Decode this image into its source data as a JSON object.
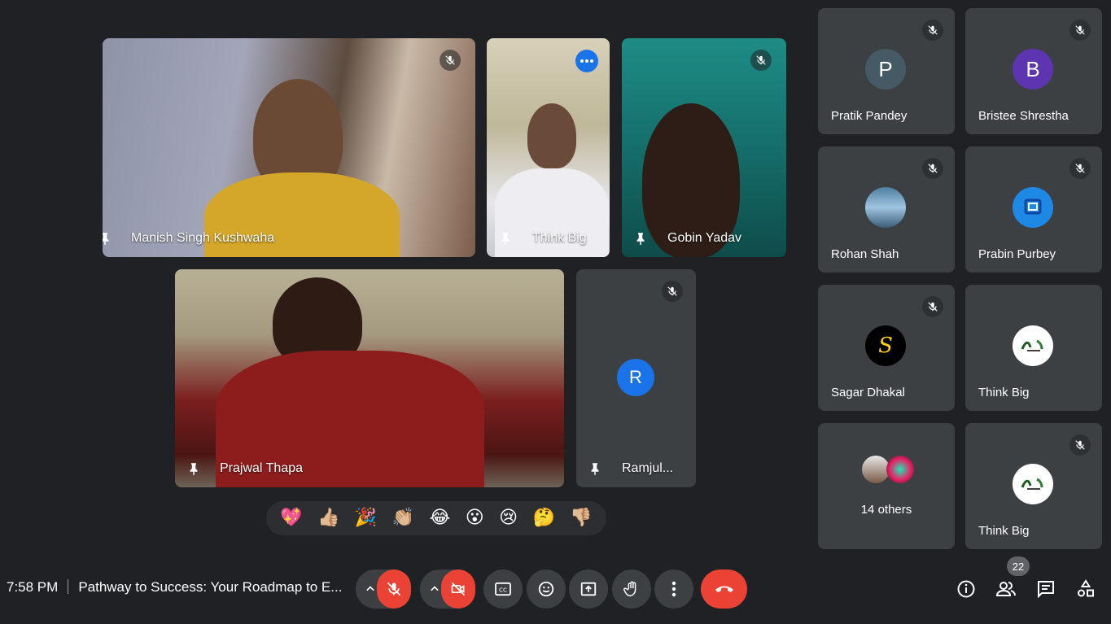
{
  "stage": {
    "tiles": [
      {
        "name": "Manish Singh Kushwaha"
      },
      {
        "name": "Think Big"
      },
      {
        "name": "Gobin Yadav"
      },
      {
        "name": "Prajwal Thapa"
      },
      {
        "name": "Ramjul...",
        "avatar": "R",
        "avatar_color": "#1a73e8"
      }
    ]
  },
  "reactions": [
    "💖",
    "👍🏼",
    "🎉",
    "👏🏼",
    "😂",
    "😮",
    "😢",
    "🤔",
    "👎🏼"
  ],
  "sidebar": {
    "participants": [
      {
        "name": "Pratik Pandey",
        "avatar": "P",
        "avatar_color": "#455a64"
      },
      {
        "name": "Bristee Shrestha",
        "avatar": "B",
        "avatar_color": "#5e35b1"
      },
      {
        "name": "Rohan Shah",
        "avatar": "",
        "avatar_color": "#4f7fa0"
      },
      {
        "name": "Prabin Purbey",
        "avatar": "",
        "avatar_color": "#1e88e5"
      },
      {
        "name": "Sagar Dhakal",
        "avatar": "S",
        "avatar_color": "#000000"
      },
      {
        "name": "Think Big",
        "avatar": "",
        "avatar_color": "#ffffff"
      },
      {
        "name": "14 others",
        "avatar": "",
        "avatar_color": "#e0e0e0"
      },
      {
        "name": "Think Big",
        "avatar": "",
        "avatar_color": "#ffffff"
      }
    ]
  },
  "bottom": {
    "time": "7:58 PM",
    "meeting_title": "Pathway to Success: Your Roadmap to E...",
    "people_count": "22"
  },
  "colors": {
    "background": "#202124",
    "tile": "#3c4043",
    "danger": "#ea4335",
    "accent": "#1a73e8"
  }
}
